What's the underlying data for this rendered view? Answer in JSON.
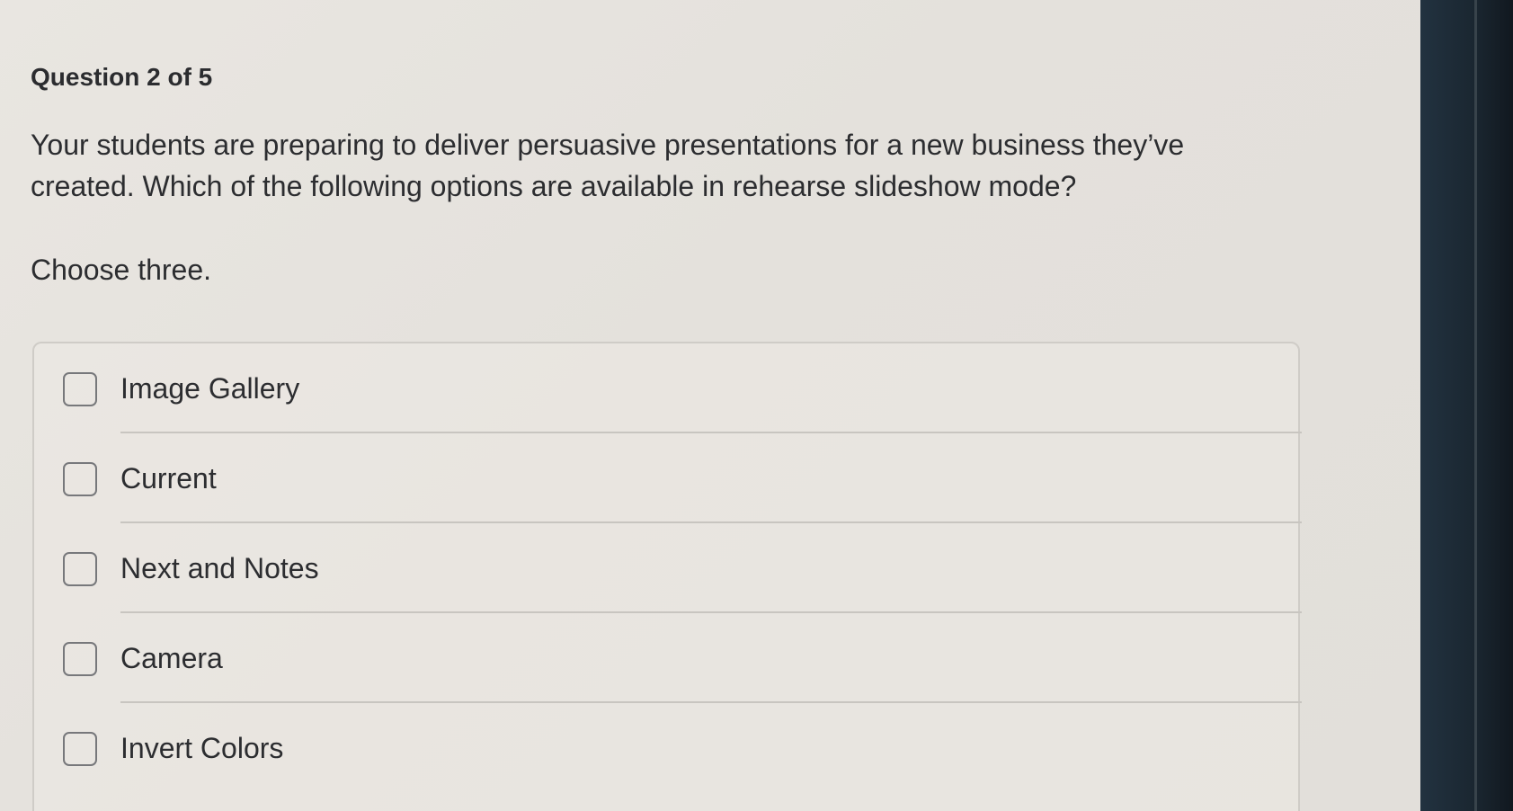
{
  "quiz": {
    "counter": "Question 2 of 5",
    "question": "Your students are preparing to deliver persuasive presentations for a new business they’ve created. Which of the following options are available in rehearse slideshow mode?",
    "instruction": "Choose three.",
    "options": [
      {
        "label": "Image Gallery",
        "checked": false
      },
      {
        "label": "Current",
        "checked": false
      },
      {
        "label": "Next and Notes",
        "checked": false
      },
      {
        "label": "Camera",
        "checked": false
      },
      {
        "label": "Invert Colors",
        "checked": false
      }
    ]
  }
}
